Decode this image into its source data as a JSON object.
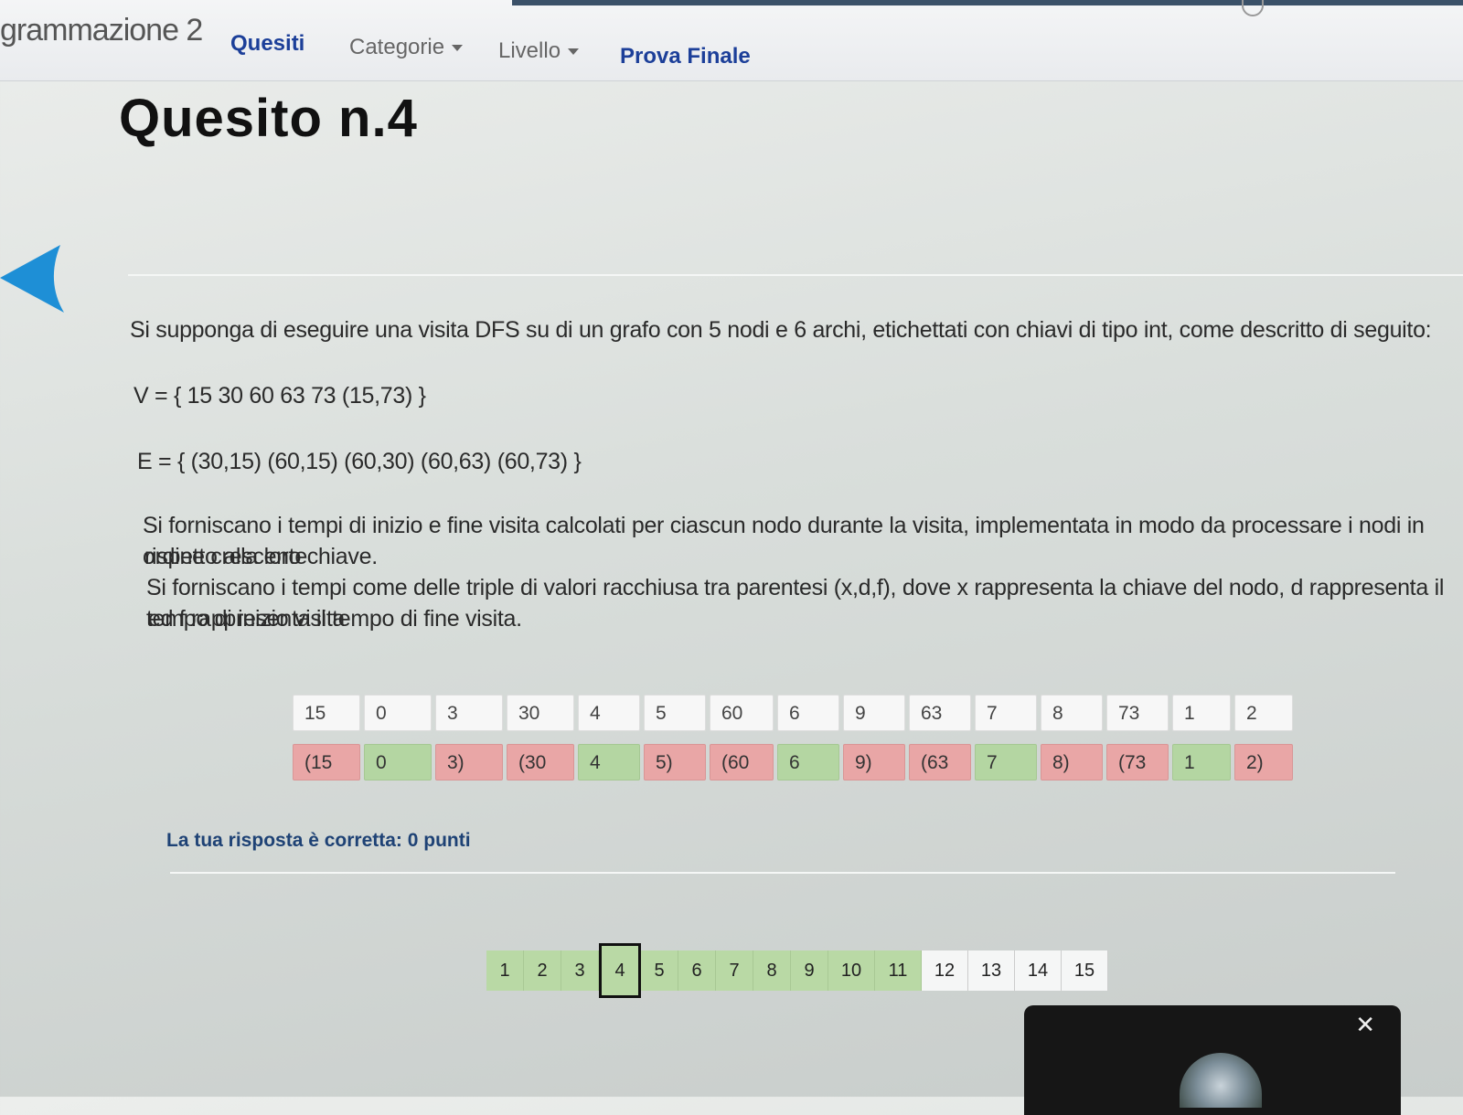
{
  "navbar": {
    "brand": "grammazione 2",
    "items": [
      {
        "label": "Quesiti",
        "active": true
      },
      {
        "label": "Categorie",
        "dropdown": true
      },
      {
        "label": "Livello",
        "dropdown": true
      },
      {
        "label": "Prova Finale",
        "active": true
      }
    ]
  },
  "page": {
    "title": "Quesito n.4"
  },
  "question": {
    "intro": "Si supponga di eseguire una visita DFS su di un grafo con 5 nodi e 6 archi, etichettati con chiavi di tipo int, come descritto di seguito:",
    "vertices": "V = { 15 30 60 63 73 (15,73) }",
    "edges": "E = { (30,15) (60,15) (60,30) (60,63) (60,73) }",
    "instr1_line1": "Si forniscano i tempi di inizio e fine visita calcolati per ciascun nodo durante la visita, implementata in modo da processare i nodi in ordine crescente",
    "instr1_line2": "rispetto alla loro chiave.",
    "instr2_line1": "Si forniscano i tempi come delle triple di valori racchiusa tra parentesi (x,d,f), dove x rappresenta la chiave del nodo, d rappresenta il tempo di inizio visita",
    "instr2_line2": "ed f rappresenta il tempo di fine visita."
  },
  "answer": {
    "inputs": [
      "15",
      "0",
      "3",
      "30",
      "4",
      "5",
      "60",
      "6",
      "9",
      "63",
      "7",
      "8",
      "73",
      "1",
      "2"
    ],
    "results": [
      {
        "text": "(15",
        "status": "red"
      },
      {
        "text": "0",
        "status": "green"
      },
      {
        "text": "3)",
        "status": "red"
      },
      {
        "text": "(30",
        "status": "red"
      },
      {
        "text": "4",
        "status": "green"
      },
      {
        "text": "5)",
        "status": "red"
      },
      {
        "text": "(60",
        "status": "red"
      },
      {
        "text": "6",
        "status": "green"
      },
      {
        "text": "9)",
        "status": "red"
      },
      {
        "text": "(63",
        "status": "red"
      },
      {
        "text": "7",
        "status": "green"
      },
      {
        "text": "8)",
        "status": "red"
      },
      {
        "text": "(73",
        "status": "red"
      },
      {
        "text": "1",
        "status": "green"
      },
      {
        "text": "2)",
        "status": "red"
      }
    ]
  },
  "feedback": "La tua risposta è corretta: 0 punti",
  "pagination": {
    "pages": [
      "1",
      "2",
      "3",
      "4",
      "5",
      "6",
      "7",
      "8",
      "9",
      "10",
      "11",
      "12",
      "13",
      "14",
      "15"
    ],
    "current": "4",
    "visited_count": 11
  },
  "popup": {
    "close_label": "✕"
  },
  "colors": {
    "nav_active": "#1c3f99",
    "wrong": "#e9a6a6",
    "right": "#b4d6a2",
    "page_visited": "#b9d9a5",
    "feedback": "#1e4275"
  }
}
